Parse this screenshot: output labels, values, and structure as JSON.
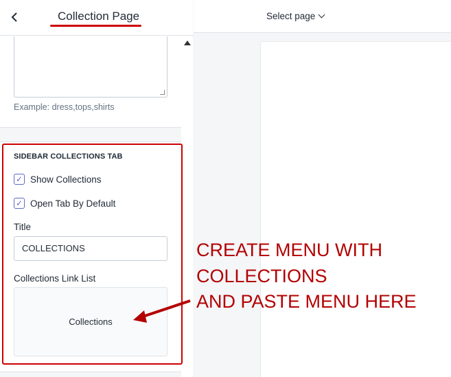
{
  "header": {
    "back_icon": "chevron-left-icon",
    "title": "Collection Page"
  },
  "tags_field": {
    "hint": "Example: dress,tops,shirts"
  },
  "sidebar_collections": {
    "heading": "SIDEBAR COLLECTIONS TAB",
    "show_collections": {
      "label": "Show Collections",
      "checked": true
    },
    "open_tab": {
      "label": "Open Tab By Default",
      "checked": true
    },
    "title_label": "Title",
    "title_value": "COLLECTIONS",
    "link_list_label": "Collections Link List",
    "link_list_value": "Collections"
  },
  "topbar": {
    "select_page": "Select page"
  },
  "annotation": {
    "lines": [
      "CREATE MENU WITH",
      "COLLECTIONS",
      "AND PASTE MENU HERE"
    ],
    "color": "#b30000"
  },
  "accent": "#5c6ac4"
}
